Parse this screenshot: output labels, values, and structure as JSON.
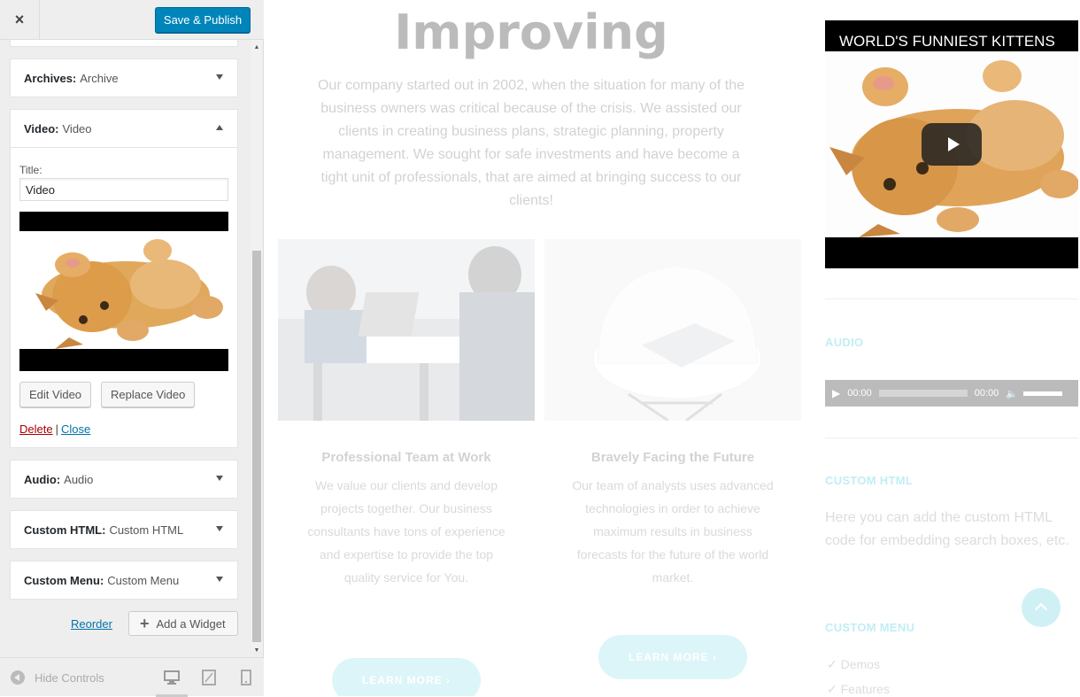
{
  "header": {
    "close_icon": "×",
    "save_label": "Save & Publish"
  },
  "widgets": [
    {
      "type": "Archives:",
      "name": "Archive"
    },
    {
      "type": "Video:",
      "name": "Video"
    },
    {
      "type": "Audio:",
      "name": "Audio"
    },
    {
      "type": "Custom HTML:",
      "name": "Custom HTML"
    },
    {
      "type": "Custom Menu:",
      "name": "Custom Menu"
    }
  ],
  "video_widget": {
    "title_label": "Title:",
    "title_value": "Video",
    "edit_label": "Edit Video",
    "replace_label": "Replace Video",
    "delete_label": "Delete",
    "separator": "|",
    "close_label": "Close"
  },
  "actions": {
    "reorder_label": "Reorder",
    "add_widget_label": "Add a Widget"
  },
  "footer": {
    "hide_controls_label": "Hide Controls"
  },
  "preview": {
    "hero_title": "Improving",
    "hero_text": "Our company started out in 2002, when the situation for many of the business owners was critical because of the crisis. We assisted our clients in creating business plans, strategic planning, property management. We sought for safe investments and have become a tight unit of professionals, that are aimed at bringing success to our clients!",
    "cards": [
      {
        "title": "Professional Team at Work",
        "text": "We value our clients and develop projects together. Our business consultants have tons of experience and expertise to provide the top quality service for You.",
        "button": "LEARN MORE ›"
      },
      {
        "title": "Bravely Facing the Future",
        "text": "Our team of analysts uses advanced technologies in order to achieve maximum results in business forecasts for the future of the world market.",
        "button": "LEARN MORE ›"
      }
    ],
    "yt_title": "WORLD'S FUNNIEST KITTENS",
    "audio_heading": "AUDIO",
    "audio_time_current": "00:00",
    "audio_time_total": "00:00",
    "custom_html_heading": "CUSTOM HTML",
    "custom_html_text": "Here you can add the custom HTML code for embedding search boxes, etc.",
    "custom_menu_heading": "CUSTOM MENU",
    "menu_items": [
      "✓  Demos",
      "✓  Features"
    ]
  },
  "colors": {
    "primary": "#0085ba",
    "accent": "#4dd0e1",
    "link": "#0073aa",
    "delete": "#a00000"
  }
}
